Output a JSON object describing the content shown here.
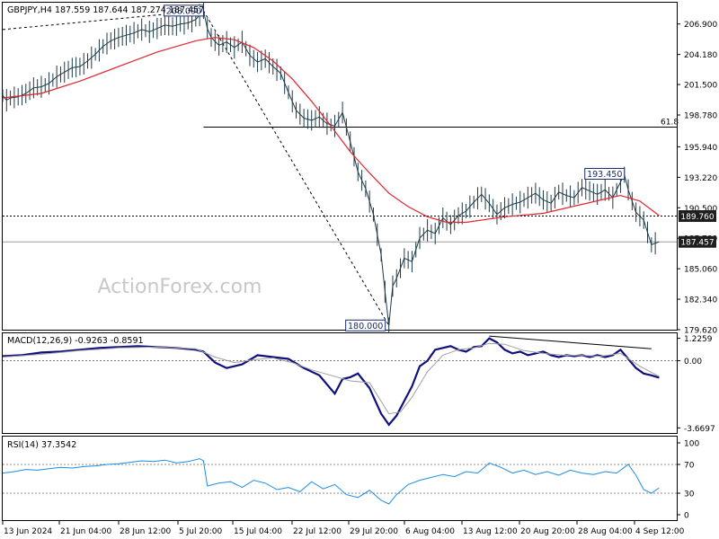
{
  "chart_data": {
    "type": "line",
    "symbol_info": "GBPJPY,H4  187.559 187.644 187.274 187.457",
    "watermark": "ActionForex.com",
    "x_labels": [
      "13 Jun 2024",
      "21 Jun 04:00",
      "28 Jun 12:00",
      "5 Jul 20:00",
      "15 Jul 04:00",
      "22 Jul 12:00",
      "29 Jul 20:00",
      "6 Aug 04:00",
      "13 Aug 12:00",
      "20 Aug 20:00",
      "28 Aug 04:00",
      "4 Sep 12:00"
    ],
    "price_panel": {
      "ylim": [
        179.62,
        208.8
      ],
      "y_ticks": [
        179.62,
        182.34,
        185.06,
        187.78,
        190.5,
        193.22,
        195.94,
        198.78,
        201.5,
        204.18,
        206.9
      ],
      "y_tick_labels": [
        "179.620",
        "182.340",
        "185.060",
        "187.780",
        "190.500",
        "193.220",
        "195.940",
        "198.780",
        "201.500",
        "204.180",
        "206.900"
      ],
      "last_price": {
        "value": 187.457,
        "label": "187.457"
      },
      "support_line": {
        "value": 189.76,
        "label": "189.760"
      },
      "fib_line": {
        "value": 197.7,
        "label": "61.8"
      },
      "annotations": [
        {
          "text": "208.090",
          "value": 208.09,
          "x": 52
        },
        {
          "text": "180.000",
          "value": 180.0,
          "x": 100
        },
        {
          "text": "193.450",
          "value": 193.45,
          "x": 161
        }
      ],
      "trendline_x": [
        0,
        52
      ],
      "trendline_y": [
        206.4,
        208.09
      ],
      "fib_leg_x": [
        52,
        100
      ],
      "fib_leg_y": [
        208.09,
        180.0
      ],
      "series": [
        {
          "role": "price",
          "color": "#1e3a46",
          "x": [
            0,
            1,
            2,
            4,
            6,
            8,
            10,
            12,
            14,
            16,
            18,
            20,
            22,
            24,
            26,
            28,
            30,
            32,
            34,
            36,
            38,
            40,
            42,
            44,
            46,
            48,
            50,
            52,
            53,
            54,
            56,
            58,
            60,
            62,
            64,
            66,
            68,
            70,
            72,
            74,
            76,
            78,
            80,
            82,
            84,
            86,
            88,
            90,
            92,
            94,
            96,
            98,
            99,
            100,
            101,
            102,
            104,
            106,
            108,
            110,
            112,
            114,
            116,
            118,
            120,
            122,
            124,
            126,
            128,
            130,
            132,
            134,
            136,
            138,
            140,
            142,
            144,
            146,
            148,
            150,
            152,
            154,
            156,
            158,
            160,
            161,
            162,
            164,
            166,
            168,
            170
          ],
          "values": [
            200.5,
            200.1,
            200.3,
            200.4,
            200.7,
            201.2,
            201.3,
            201.6,
            202.2,
            202.6,
            203.0,
            203.1,
            203.6,
            204.2,
            204.9,
            205.4,
            205.7,
            205.9,
            206.1,
            206.4,
            206.2,
            206.5,
            206.8,
            206.7,
            206.9,
            207.0,
            207.3,
            208.09,
            206.5,
            205.7,
            205.0,
            205.3,
            204.8,
            205.3,
            204.1,
            203.5,
            203.8,
            203.1,
            202.5,
            200.8,
            199.2,
            198.5,
            198.3,
            198.6,
            198.0,
            197.8,
            199.0,
            196.4,
            193.7,
            192.2,
            189.9,
            186.3,
            183.0,
            180.0,
            183.5,
            184.2,
            186.0,
            185.7,
            187.8,
            188.5,
            188.2,
            189.6,
            189.0,
            189.8,
            190.2,
            191.0,
            191.7,
            190.9,
            189.9,
            190.5,
            190.8,
            191.0,
            191.4,
            191.8,
            191.2,
            190.9,
            191.9,
            191.6,
            191.4,
            192.3,
            192.0,
            191.7,
            192.1,
            191.4,
            192.8,
            193.45,
            192.1,
            190.1,
            189.4,
            187.2,
            187.457
          ]
        },
        {
          "role": "moving-average",
          "color": "#e2242e",
          "x": [
            0,
            10,
            20,
            30,
            40,
            50,
            55,
            60,
            65,
            70,
            75,
            80,
            85,
            90,
            95,
            100,
            105,
            110,
            115,
            120,
            130,
            140,
            150,
            160,
            165,
            170
          ],
          "values": [
            200.3,
            200.7,
            201.8,
            203.1,
            204.4,
            205.4,
            205.7,
            205.5,
            204.8,
            203.6,
            202.0,
            200.0,
            197.8,
            195.5,
            193.6,
            191.8,
            190.6,
            189.7,
            189.2,
            189.2,
            189.7,
            190.0,
            190.8,
            191.6,
            191.1,
            189.8
          ]
        }
      ]
    },
    "macd_panel": {
      "label": "MACD(12,26,9) -0.9263 -0.8591",
      "ylim": [
        -3.95,
        1.5
      ],
      "y_ticks": [
        1.2259,
        0.0,
        -3.6697
      ],
      "y_tick_labels": [
        "1.2259",
        "0.00",
        "-3.6697"
      ],
      "divergence_x": [
        126,
        168
      ],
      "divergence_y": [
        1.35,
        0.65
      ],
      "series": [
        {
          "role": "macd",
          "color": "#0f0f7d",
          "x": [
            0,
            5,
            10,
            15,
            20,
            25,
            30,
            35,
            40,
            45,
            50,
            52,
            55,
            58,
            62,
            66,
            70,
            74,
            78,
            82,
            86,
            88,
            90,
            92,
            95,
            98,
            100,
            102,
            104,
            106,
            108,
            110,
            112,
            114,
            116,
            118,
            120,
            122,
            124,
            126,
            128,
            130,
            132,
            134,
            136,
            138,
            140,
            142,
            144,
            146,
            148,
            150,
            152,
            154,
            156,
            158,
            160,
            162,
            164,
            166,
            168,
            170
          ],
          "values": [
            0.25,
            0.3,
            0.45,
            0.5,
            0.6,
            0.7,
            0.75,
            0.8,
            0.75,
            0.7,
            0.6,
            0.5,
            -0.1,
            -0.4,
            -0.2,
            0.3,
            0.2,
            0.1,
            -0.4,
            -0.8,
            -1.8,
            -1.0,
            -0.9,
            -0.7,
            -1.5,
            -2.9,
            -3.5,
            -3.0,
            -2.2,
            -1.4,
            -0.3,
            0.0,
            0.6,
            0.7,
            0.8,
            0.6,
            0.5,
            0.75,
            0.8,
            1.2259,
            1.0,
            0.6,
            0.4,
            0.5,
            0.3,
            0.4,
            0.5,
            0.3,
            0.2,
            0.3,
            0.25,
            0.3,
            0.2,
            0.3,
            0.2,
            0.3,
            0.6,
            0.1,
            -0.4,
            -0.7,
            -0.8,
            -0.9263
          ]
        },
        {
          "role": "signal",
          "color": "#a0a0a0",
          "x": [
            0,
            10,
            20,
            30,
            40,
            50,
            55,
            60,
            65,
            70,
            75,
            80,
            85,
            90,
            95,
            100,
            103,
            106,
            110,
            114,
            118,
            122,
            126,
            130,
            135,
            140,
            145,
            150,
            155,
            160,
            165,
            170
          ],
          "values": [
            0.2,
            0.35,
            0.55,
            0.7,
            0.75,
            0.65,
            0.2,
            -0.1,
            0.05,
            0.15,
            -0.1,
            -0.5,
            -0.8,
            -1.1,
            -1.2,
            -2.9,
            -2.8,
            -2.0,
            -0.6,
            0.3,
            0.6,
            0.7,
            0.95,
            0.9,
            0.55,
            0.4,
            0.3,
            0.28,
            0.25,
            0.4,
            -0.3,
            -0.8591
          ]
        }
      ]
    },
    "rsi_panel": {
      "label": "RSI(14) 37.3542",
      "ylim": [
        0,
        100
      ],
      "y_ticks": [
        100,
        70,
        30,
        0
      ],
      "y_tick_labels": [
        "100",
        "70",
        "30",
        "0"
      ],
      "series": [
        {
          "role": "rsi",
          "color": "#1c8ce6",
          "x": [
            0,
            3,
            6,
            9,
            12,
            15,
            18,
            21,
            24,
            27,
            30,
            33,
            36,
            39,
            42,
            45,
            48,
            51,
            52,
            53,
            56,
            59,
            62,
            65,
            68,
            71,
            74,
            77,
            80,
            83,
            86,
            89,
            92,
            95,
            98,
            100,
            102,
            105,
            108,
            111,
            114,
            117,
            120,
            123,
            126,
            129,
            132,
            135,
            138,
            141,
            144,
            147,
            150,
            153,
            156,
            159,
            162,
            164,
            166,
            168,
            170
          ],
          "values": [
            58,
            60,
            63,
            62,
            64,
            66,
            65,
            67,
            68,
            70,
            71,
            73,
            75,
            74,
            76,
            72,
            74,
            78,
            75,
            40,
            44,
            46,
            38,
            48,
            44,
            35,
            38,
            32,
            46,
            36,
            42,
            28,
            24,
            34,
            20,
            15,
            28,
            42,
            48,
            52,
            56,
            53,
            60,
            58,
            72,
            66,
            58,
            62,
            56,
            60,
            55,
            62,
            58,
            56,
            60,
            58,
            70,
            55,
            35,
            30,
            37.3542
          ]
        }
      ]
    }
  }
}
